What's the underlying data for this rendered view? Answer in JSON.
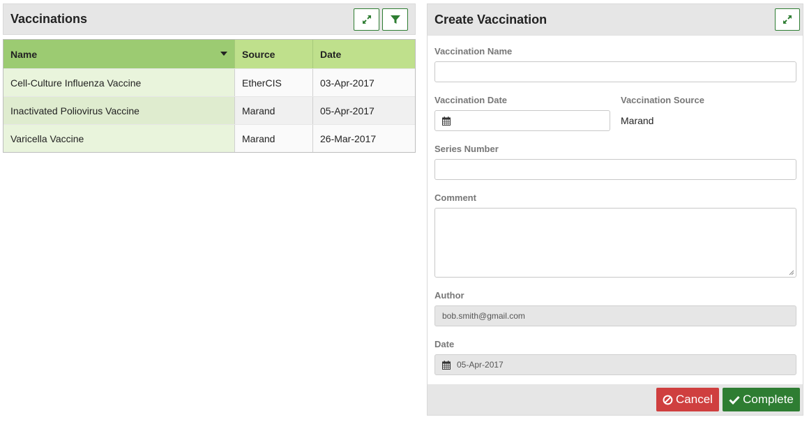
{
  "vaccinations_panel": {
    "title": "Vaccinations",
    "expand_icon": "expand-icon",
    "filter_icon": "filter-icon",
    "columns": {
      "name": "Name",
      "source": "Source",
      "date": "Date"
    },
    "rows": [
      {
        "name": "Cell-Culture Influenza Vaccine",
        "source": "EtherCIS",
        "date": "03-Apr-2017"
      },
      {
        "name": "Inactivated Poliovirus Vaccine",
        "source": "Marand",
        "date": "05-Apr-2017"
      },
      {
        "name": "Varicella Vaccine",
        "source": "Marand",
        "date": "26-Mar-2017"
      }
    ]
  },
  "create_panel": {
    "title": "Create Vaccination",
    "expand_icon": "expand-icon",
    "fields": {
      "vaccination_name_label": "Vaccination Name",
      "vaccination_name_value": "",
      "vaccination_date_label": "Vaccination Date",
      "vaccination_date_value": "",
      "vaccination_source_label": "Vaccination Source",
      "vaccination_source_value": "Marand",
      "series_number_label": "Series Number",
      "series_number_value": "",
      "comment_label": "Comment",
      "comment_value": "",
      "author_label": "Author",
      "author_value": "bob.smith@gmail.com",
      "date_label": "Date",
      "date_value": "05-Apr-2017"
    },
    "buttons": {
      "cancel": "Cancel",
      "complete": "Complete"
    }
  },
  "colors": {
    "accent_green": "#2e7d32",
    "header_green": "#9ccb72",
    "header_light_green": "#bfe08c",
    "cancel_red": "#cf3f3f"
  }
}
